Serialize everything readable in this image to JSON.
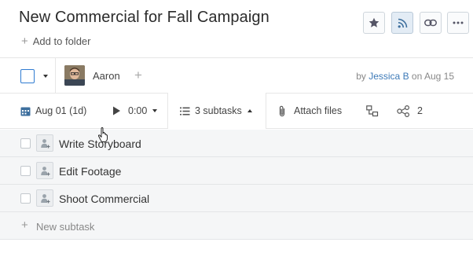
{
  "task": {
    "title": "New Commercial for Fall Campaign",
    "add_folder_label": "Add to folder"
  },
  "top_actions": {
    "star_icon": "star-icon",
    "rss_icon": "rss-icon",
    "link_icon": "link-icon",
    "more_icon": "more-icon",
    "rss_active_color": "#e3ecf5"
  },
  "assignment": {
    "assignee_name": "Aaron",
    "add_symbol": "+",
    "by_prefix": "by",
    "author": "Jessica B",
    "on_prefix": "on",
    "date": "Aug 15"
  },
  "toolbar": {
    "date_label": "Aug 01 (1d)",
    "time_label": "0:00",
    "subtasks_label": "3 subtasks",
    "attach_label": "Attach files",
    "dependencies_count": "2"
  },
  "subtasks": [
    {
      "label": "Write Storyboard"
    },
    {
      "label": "Edit Footage"
    },
    {
      "label": "Shoot Commercial"
    }
  ],
  "new_subtask": {
    "plus": "+",
    "label": "New subtask"
  },
  "colors": {
    "accent": "#2f7bd1",
    "link": "#3d7ab8",
    "list_bg": "#f5f6f7"
  }
}
